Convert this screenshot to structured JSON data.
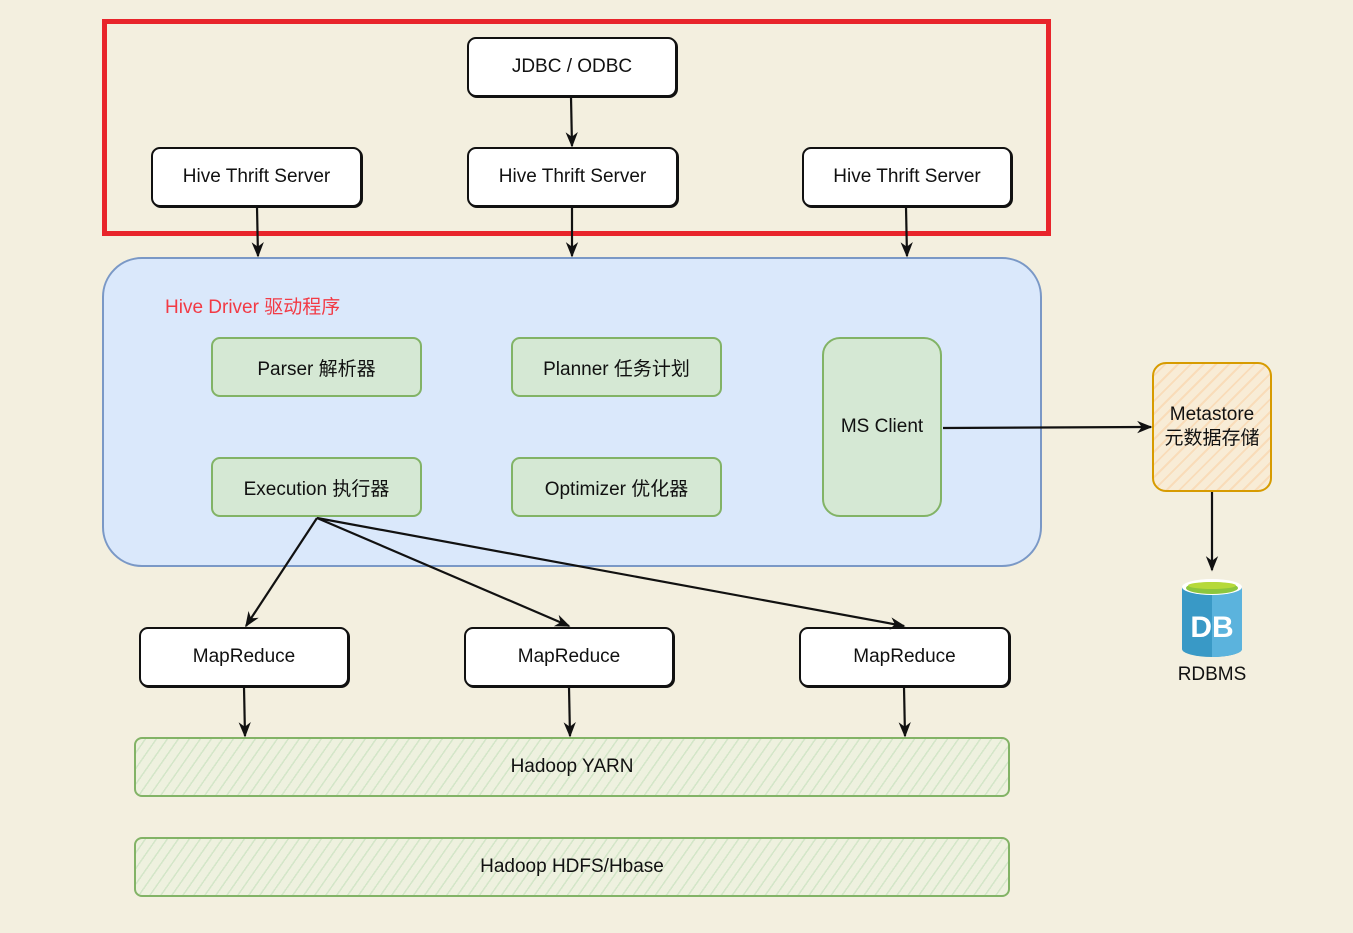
{
  "diagram": {
    "client_layer": {
      "jdbc": "JDBC / ODBC",
      "thrift_servers": [
        "Hive Thrift Server",
        "Hive Thrift Server",
        "Hive Thrift Server"
      ]
    },
    "driver": {
      "title": "Hive Driver 驱动程序",
      "components": {
        "parser": "Parser 解析器",
        "planner": "Planner 任务计划",
        "execution": "Execution 执行器",
        "optimizer": "Optimizer 优化器",
        "ms_client": "MS Client"
      }
    },
    "metastore": {
      "line1": "Metastore",
      "line2": "元数据存储"
    },
    "rdbms": {
      "icon_text": "DB",
      "label": "RDBMS"
    },
    "mapreduce": [
      "MapReduce",
      "MapReduce",
      "MapReduce"
    ],
    "layers": {
      "yarn": "Hadoop YARN",
      "hdfs": "Hadoop HDFS/Hbase"
    },
    "colors": {
      "background": "#f3efdf",
      "client_group_border": "#e8242b",
      "driver_fill": "#dae8fb",
      "driver_border": "#7a98c6",
      "driver_title": "#f23a45",
      "component_fill": "#d5e8d4",
      "component_border": "#82b366",
      "metastore_border": "#d79b00",
      "db_blue": "#3999c6",
      "db_green": "#8cc63e"
    }
  }
}
